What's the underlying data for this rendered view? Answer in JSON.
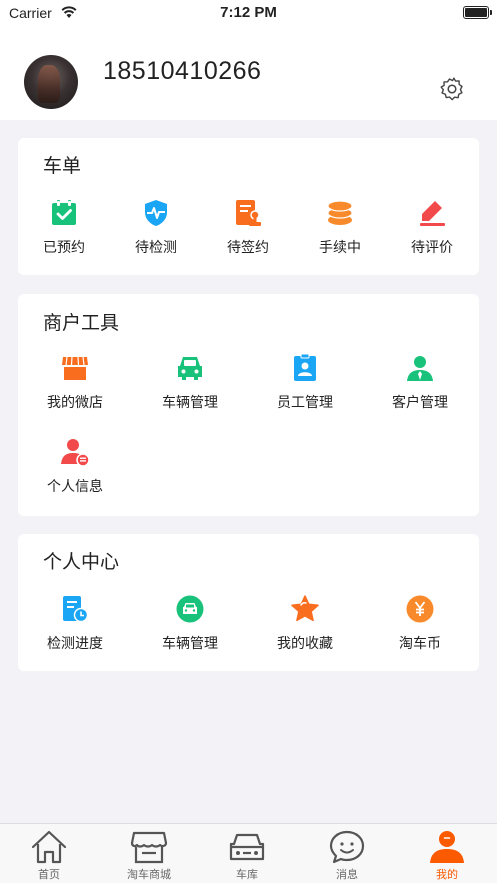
{
  "status": {
    "carrier": "Carrier",
    "time": "7:12 PM"
  },
  "profile": {
    "phone": "18510410266"
  },
  "orders": {
    "title": "车单",
    "items": [
      {
        "label": "已预约",
        "icon": "calendar-check-icon",
        "color": "#19c27a"
      },
      {
        "label": "待检测",
        "icon": "shield-pulse-icon",
        "color": "#1aa6f4"
      },
      {
        "label": "待签约",
        "icon": "contract-stamp-icon",
        "color": "#f96d1e"
      },
      {
        "label": "手续中",
        "icon": "coin-stack-icon",
        "color": "#f98a2c"
      },
      {
        "label": "待评价",
        "icon": "pencil-edit-icon",
        "color": "#f24a4a"
      }
    ]
  },
  "merchant": {
    "title": "商户工具",
    "items": [
      {
        "label": "我的微店",
        "icon": "store-icon",
        "color": "#f96d1e"
      },
      {
        "label": "车辆管理",
        "icon": "car-icon",
        "color": "#19c27a"
      },
      {
        "label": "员工管理",
        "icon": "badge-icon",
        "color": "#1aa6f4"
      },
      {
        "label": "客户管理",
        "icon": "person-tie-icon",
        "color": "#19c27a"
      },
      {
        "label": "个人信息",
        "icon": "user-info-icon",
        "color": "#f24a4a"
      }
    ]
  },
  "personal": {
    "title": "个人中心",
    "items": [
      {
        "label": "检测进度",
        "icon": "report-clock-icon",
        "color": "#1aa6f4"
      },
      {
        "label": "车辆管理",
        "icon": "car-circle-icon",
        "color": "#19c27a"
      },
      {
        "label": "我的收藏",
        "icon": "star-icon",
        "color": "#f96d1e"
      },
      {
        "label": "淘车币",
        "icon": "yuan-coin-icon",
        "color": "#f98a2c"
      }
    ]
  },
  "tabs": [
    {
      "label": "首页",
      "icon": "home-icon"
    },
    {
      "label": "淘车商城",
      "icon": "shop-icon"
    },
    {
      "label": "车库",
      "icon": "garage-car-icon"
    },
    {
      "label": "消息",
      "icon": "message-icon"
    },
    {
      "label": "我的",
      "icon": "profile-icon",
      "active": true
    }
  ],
  "colors": {
    "accent": "#fb5a00",
    "background": "#f3f3f7"
  }
}
